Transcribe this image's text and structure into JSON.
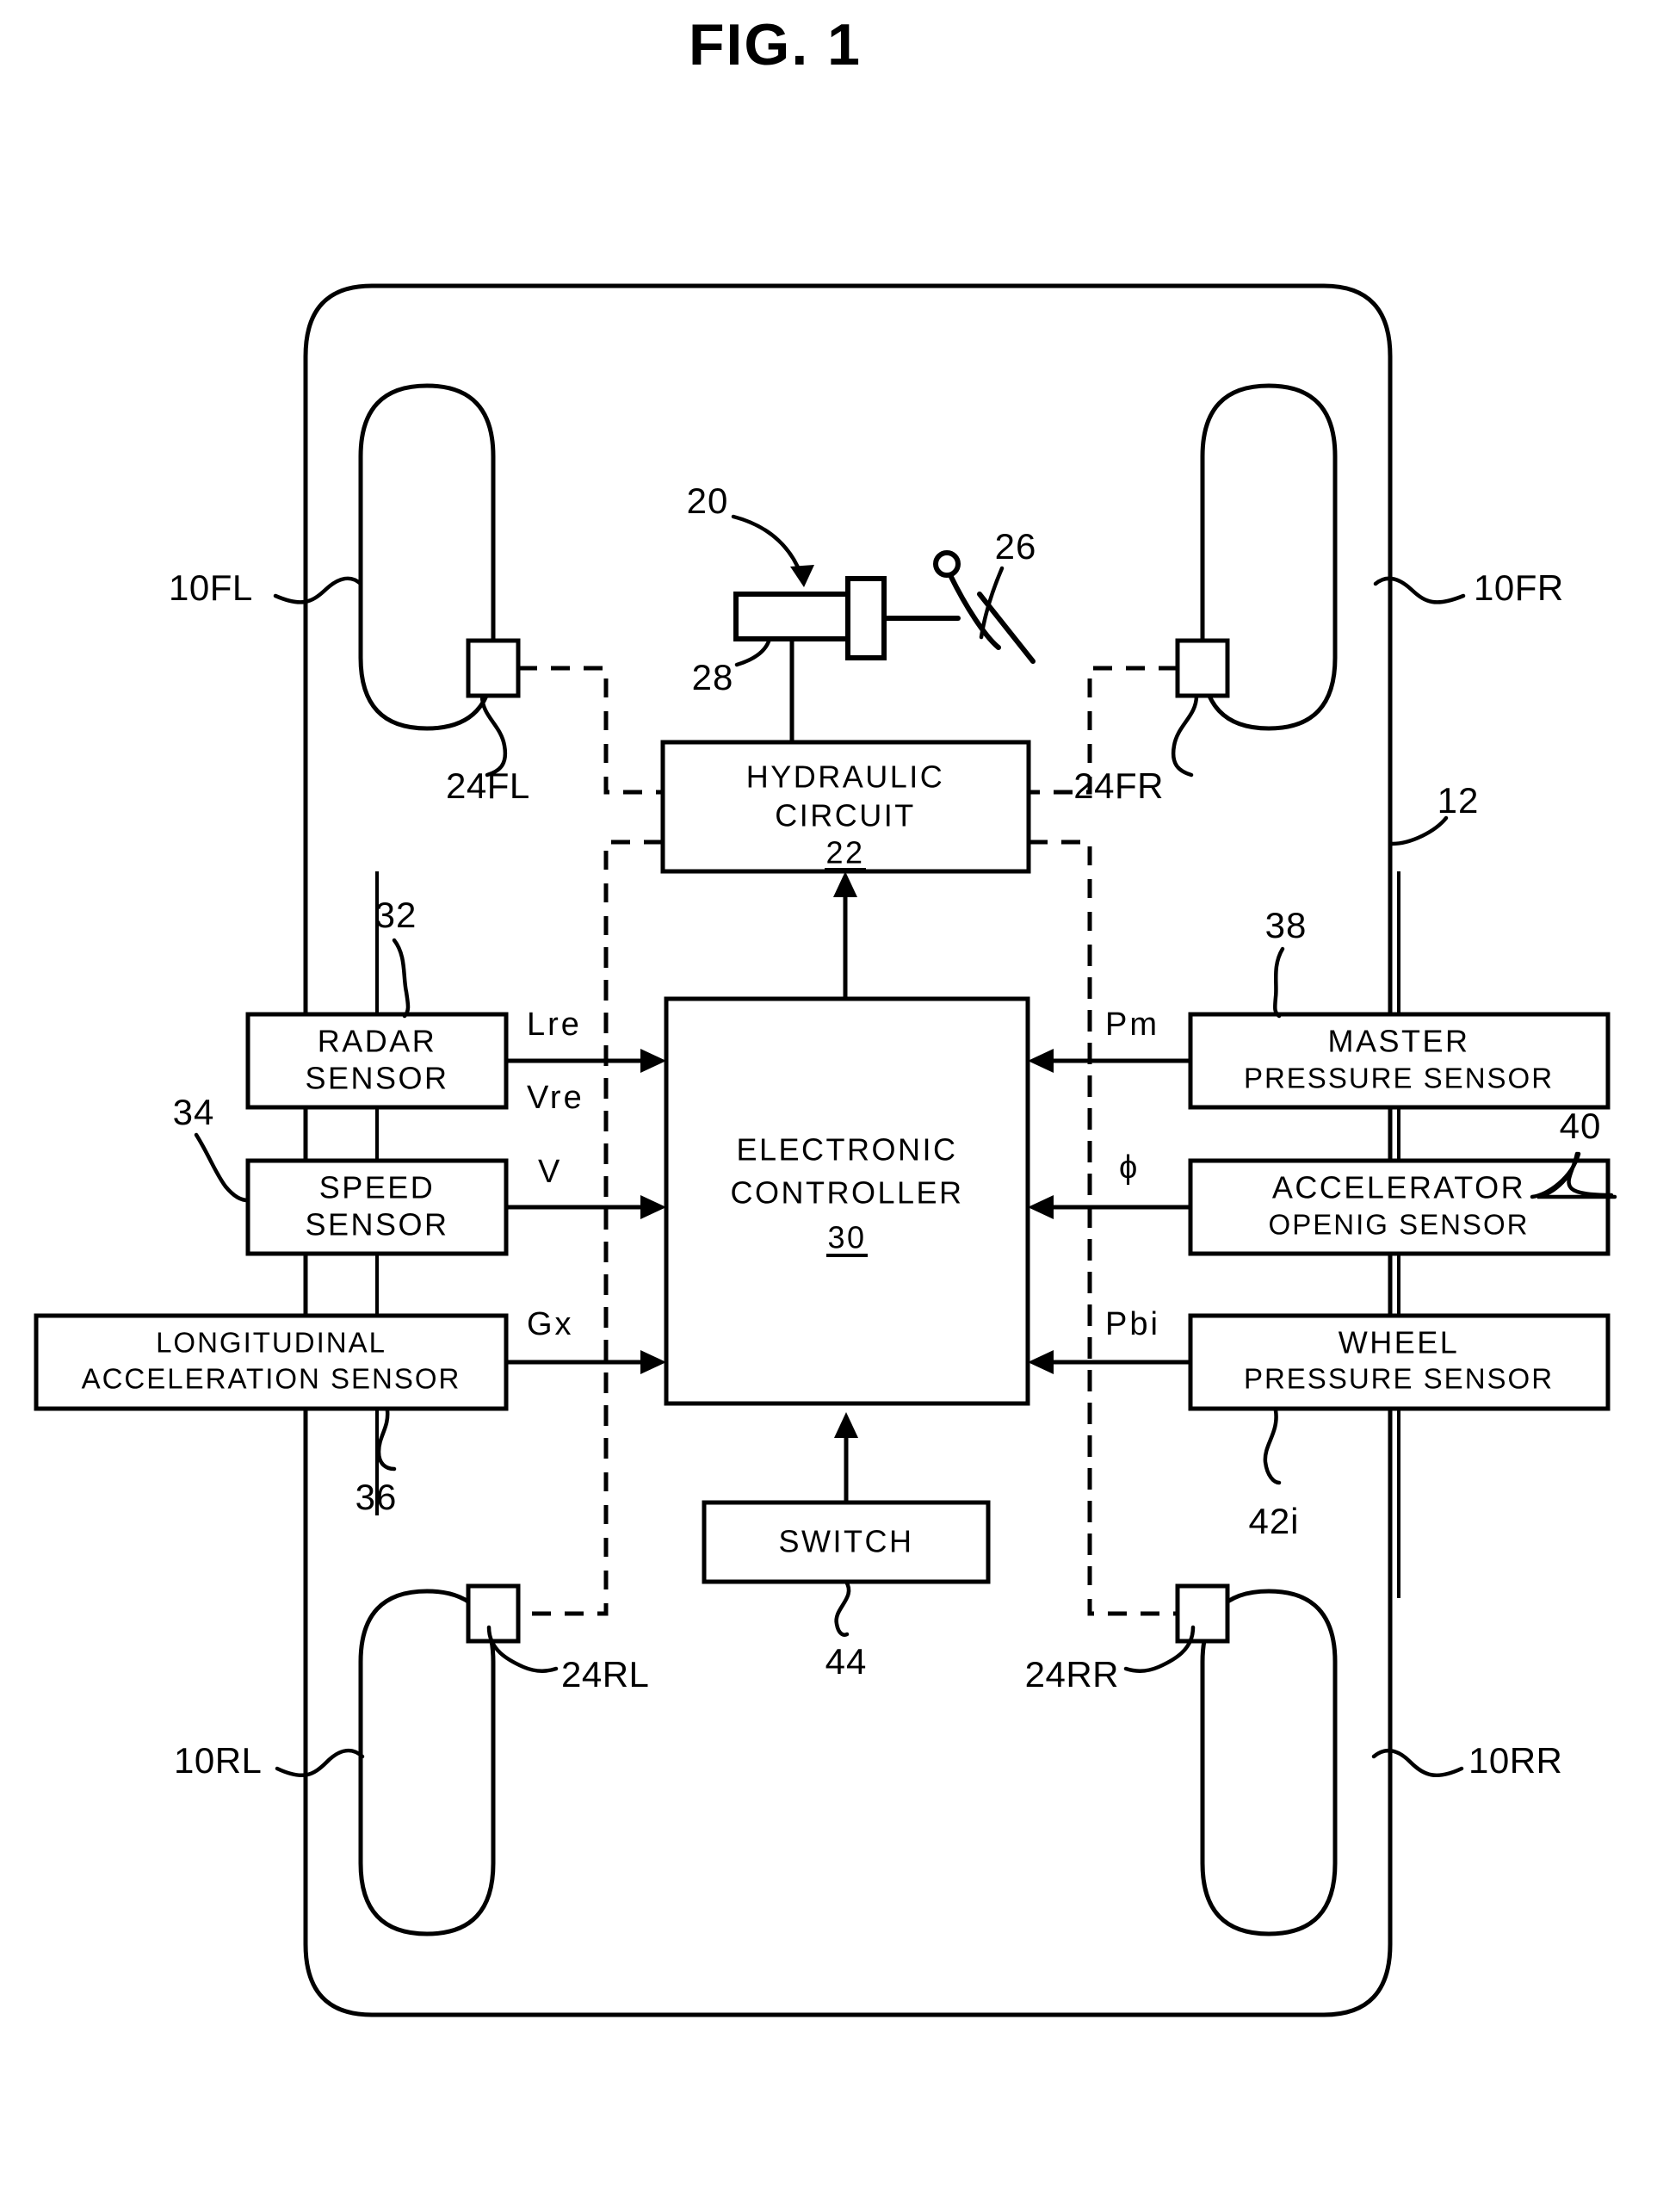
{
  "figure": {
    "title": "FIG. 1",
    "domain_label": "vehicle-brake-control-system-block-diagram"
  },
  "vehicle": {
    "body_ref": "12",
    "wheels": [
      {
        "id": "front-left",
        "label": "10FL",
        "cylinder_label": "24FL"
      },
      {
        "id": "front-right",
        "label": "10FR",
        "cylinder_label": "24FR"
      },
      {
        "id": "rear-left",
        "label": "10RL",
        "cylinder_label": "24RL"
      },
      {
        "id": "rear-right",
        "label": "10RR",
        "cylinder_label": "24RR"
      }
    ]
  },
  "master_cylinder": {
    "assembly_ref": "20",
    "pedal_ref": "26",
    "reservoir_ref": "28"
  },
  "blocks": {
    "hydraulic_circuit": {
      "line1": "HYDRAULIC",
      "line2": "CIRCUIT",
      "ref": "22"
    },
    "electronic_controller": {
      "line1": "ELECTRONIC",
      "line2": "CONTROLLER",
      "ref": "30"
    },
    "radar_sensor": {
      "line1": "RADAR",
      "line2": "SENSOR",
      "ref": "32"
    },
    "speed_sensor": {
      "line1": "SPEED",
      "line2": "SENSOR",
      "ref": "34"
    },
    "longitudinal_acceleration_sensor": {
      "line1": "LONGITUDINAL",
      "line2": "ACCELERATION SENSOR",
      "ref": "36"
    },
    "master_pressure_sensor": {
      "line1": "MASTER",
      "line2": "PRESSURE SENSOR",
      "ref": "38"
    },
    "accelerator_opening_sensor": {
      "line1": "ACCELERATOR",
      "line2": "OPENIG SENSOR",
      "ref": "40"
    },
    "wheel_pressure_sensor": {
      "line1": "WHEEL",
      "line2": "PRESSURE SENSOR",
      "ref": "42i"
    },
    "switch": {
      "line1": "SWITCH",
      "ref": "44"
    }
  },
  "signals": {
    "radar_distance": "Lre",
    "radar_relative_speed": "Vre",
    "vehicle_speed": "V",
    "longitudinal_accel": "Gx",
    "master_pressure": "Pm",
    "accelerator_opening": "ϕ",
    "wheel_pressure": "Pbi"
  },
  "colors": {
    "ink": "#000000",
    "paper": "#ffffff"
  }
}
